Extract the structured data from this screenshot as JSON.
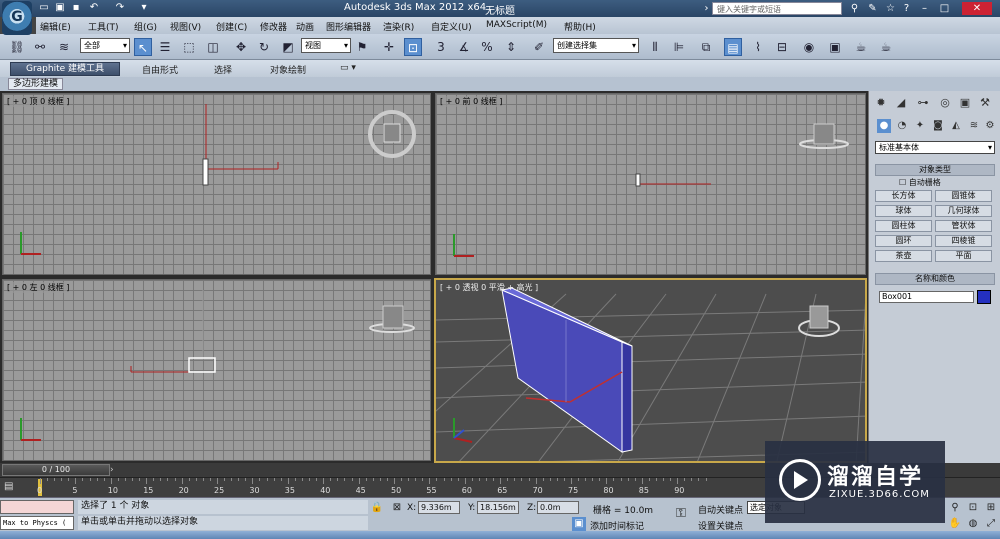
{
  "title_bar": {
    "app_logo_letter": "G",
    "window_title": "Autodesk 3ds Max  2012 x64",
    "document_title": "无标题",
    "help_search_placeholder": "键入关键字或短语"
  },
  "menu": [
    "编辑(E)",
    "工具(T)",
    "组(G)",
    "视图(V)",
    "创建(C)",
    "修改器",
    "动画",
    "图形编辑器",
    "渲染(R)",
    "自定义(U)",
    "MAXScript(M)",
    "帮助(H)"
  ],
  "toolbar": {
    "selection_filter": "全部",
    "reference_coord": "视图",
    "snap_labels": [
      "3",
      "%"
    ],
    "named_selection_placeholder": "创建选择集"
  },
  "ribbon": {
    "tabs": [
      "Graphite 建模工具",
      "自由形式",
      "选择",
      "对象绘制"
    ],
    "active_subtab": "多边形建模"
  },
  "viewports": {
    "top": "[ + 0 顶 0 线框 ]",
    "front": "[ + 0 前 0 线框 ]",
    "left": "[ + 0 左 0 线框 ]",
    "perspective": "[ + 0 透视 0 平滑 + 高光 ]"
  },
  "command_panel": {
    "category_dropdown": "标准基本体",
    "object_type_header": "对象类型",
    "autogrid_label": "自动栅格",
    "primitives": [
      "长方体",
      "圆锥体",
      "球体",
      "几何球体",
      "圆柱体",
      "管状体",
      "圆环",
      "四棱锥",
      "茶壶",
      "平面"
    ],
    "name_color_header": "名称和颜色",
    "object_name": "Box001",
    "object_color": "#2430c0"
  },
  "timeline": {
    "frame_display": "0 / 100",
    "ticks": [
      "0",
      "5",
      "10",
      "15",
      "20",
      "25",
      "30",
      "35",
      "40",
      "45",
      "50",
      "55",
      "60",
      "65",
      "70",
      "75",
      "80",
      "85",
      "90"
    ]
  },
  "status": {
    "maxscript_text": "Max to Physcs (",
    "line1": "选择了 1 个 对象",
    "line2": "单击或单击并拖动以选择对象",
    "x_label": "X:",
    "x_value": "9.336m",
    "y_label": "Y:",
    "y_value": "18.156m",
    "z_label": "Z:",
    "z_value": "0.0m",
    "grid": "栅格 = 10.0m",
    "add_time_tag": "添加时间标记",
    "auto_key": "自动关键点",
    "set_key": "设置关键点",
    "key_mode": "选定对象"
  },
  "watermark": {
    "title": "溜溜自学",
    "url": "ZIXUE.3D66.COM"
  }
}
